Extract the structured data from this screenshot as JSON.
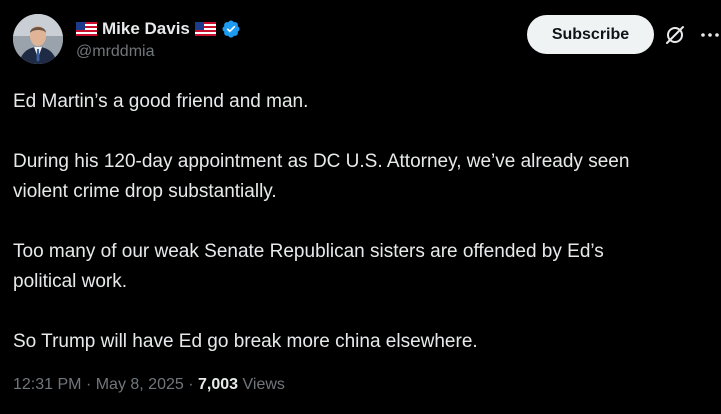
{
  "author": {
    "display_name": "Mike Davis",
    "handle": "@mrddmia",
    "avatar_icon": "profile-photo",
    "flag_icon": "us-flag-icon",
    "verified_icon": "verified-badge-icon",
    "verified_color": "#1d9bf0"
  },
  "actions": {
    "subscribe_label": "Subscribe",
    "grok_icon": "grok-icon",
    "more_icon": "more-options-icon"
  },
  "tweet": {
    "paragraphs": [
      [
        "Ed Martin’s a good friend and man."
      ],
      [
        "During his 120-day appointment as DC U.S. Attorney, we’ve already seen",
        "violent crime drop substantially."
      ],
      [
        "Too many of our weak Senate Republican sisters are offended by Ed’s",
        "political work."
      ],
      [
        "So Trump will have Ed go break more china elsewhere."
      ]
    ]
  },
  "meta": {
    "time": "12:31 PM",
    "separator": "·",
    "date": "May 8, 2025",
    "views_count": "7,003",
    "views_label": "Views"
  },
  "colors": {
    "background": "#000000",
    "text_primary": "#e7e9ea",
    "text_secondary": "#71767b",
    "button_bg": "#eff3f4",
    "button_text": "#0f1419"
  }
}
